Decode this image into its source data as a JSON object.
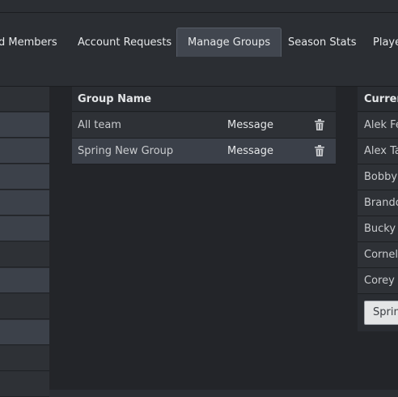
{
  "nav": {
    "tabs": [
      {
        "label": "d Members"
      },
      {
        "label": "Account Requests"
      },
      {
        "label": "Manage Groups",
        "active": true
      },
      {
        "label": "Season Stats"
      },
      {
        "label": "Playe"
      }
    ]
  },
  "groups": {
    "header": "Group Name",
    "rows": [
      {
        "name": "All team",
        "action": "Message",
        "delete_icon": "trash-icon"
      },
      {
        "name": "Spring New Group",
        "action": "Message",
        "delete_icon": "trash-icon"
      }
    ]
  },
  "current": {
    "header": "Curren",
    "members": [
      "Alek Fe",
      "Alex Ta",
      "Bobby",
      "Brando",
      "Bucky F",
      "Cornell",
      "Corey C"
    ],
    "button_label": "Sprin"
  },
  "colors": {
    "background": "#2b2e33",
    "active_tab": "#41464f",
    "selected_row": "#3b4049",
    "button": "#e4e5e6"
  }
}
